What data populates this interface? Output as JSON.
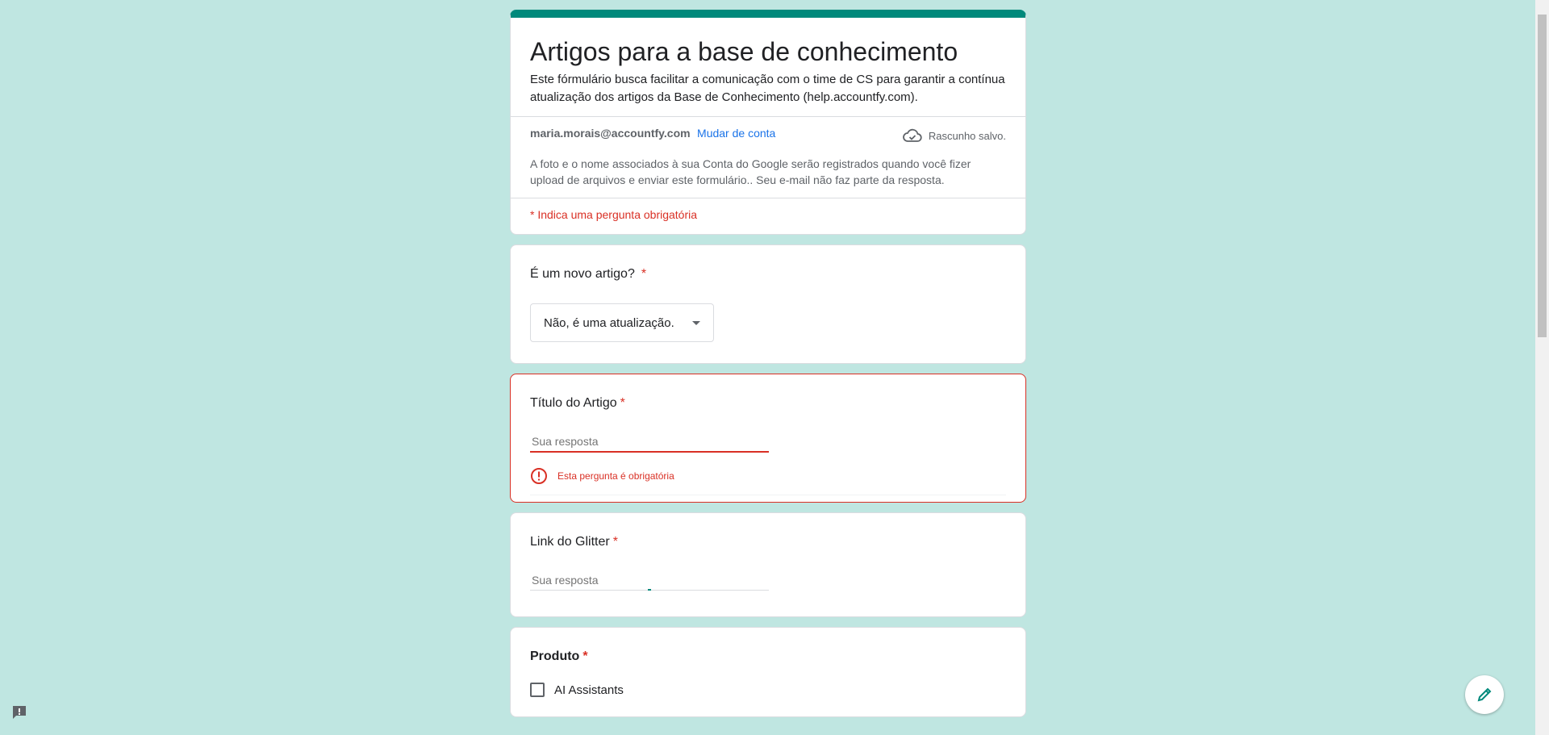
{
  "form": {
    "title": "Artigos para a base de conhecimento",
    "description": "Este fórmulário busca facilitar a comunicação com o time de CS para garantir a contínua atualização dos artigos da Base de Conhecimento (help.accountfy.com).",
    "account_email": "maria.morais@accountfy.com",
    "switch_account": "Mudar de conta",
    "draft_status": "Rascunho salvo.",
    "notice": "A foto e o nome associados à sua Conta do Google serão registrados quando você fizer upload de arquivos e enviar este formulário.. Seu e-mail não faz parte da resposta.",
    "required_note": "* Indica uma pergunta obrigatória"
  },
  "questions": {
    "q1": {
      "title": "É um novo artigo?",
      "star": "*",
      "selected": "Não, é uma atualização."
    },
    "q2": {
      "title": "Título do Artigo",
      "star": "*",
      "placeholder": "Sua resposta",
      "error": "Esta pergunta é obrigatória"
    },
    "q3": {
      "title": "Link do Glitter",
      "star": "*",
      "placeholder": "Sua resposta"
    },
    "q4": {
      "title": "Produto",
      "star": "*",
      "option1": "AI Assistants"
    }
  },
  "colors": {
    "accent": "#00897b",
    "error": "#d93025",
    "background": "#bfe6e1",
    "link": "#1a73e8"
  },
  "icons": {
    "draft": "cloud-check-icon",
    "error": "error-circle-icon",
    "fab": "pencil-icon",
    "feedback": "feedback-icon"
  }
}
